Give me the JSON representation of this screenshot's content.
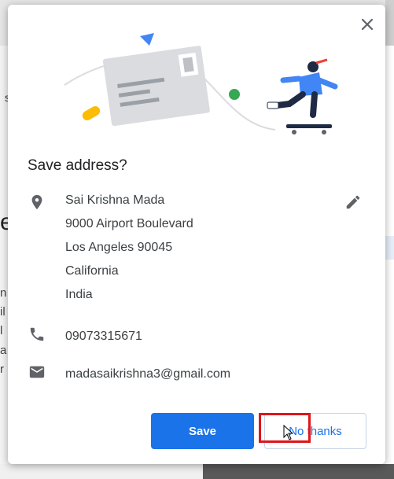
{
  "background": {
    "fragments": [
      "s",
      "e",
      "n",
      "il",
      "l",
      "a",
      "r"
    ]
  },
  "dialog": {
    "title": "Save address?",
    "close_icon": "close-icon",
    "address": {
      "icon": "location-pin-icon",
      "lines": [
        "Sai Krishna Mada",
        "9000 Airport Boulevard",
        "Los Angeles 90045",
        "California",
        "India"
      ],
      "edit_icon": "pencil-icon"
    },
    "phone": {
      "icon": "phone-icon",
      "value": "09073315671"
    },
    "email": {
      "icon": "mail-icon",
      "value": "madasaikrishna3@gmail.com"
    },
    "buttons": {
      "save": "Save",
      "no_thanks": "No thanks"
    }
  },
  "colors": {
    "primary": "#1a73e8",
    "highlight": "#e0141b",
    "text": "#3c4043"
  }
}
